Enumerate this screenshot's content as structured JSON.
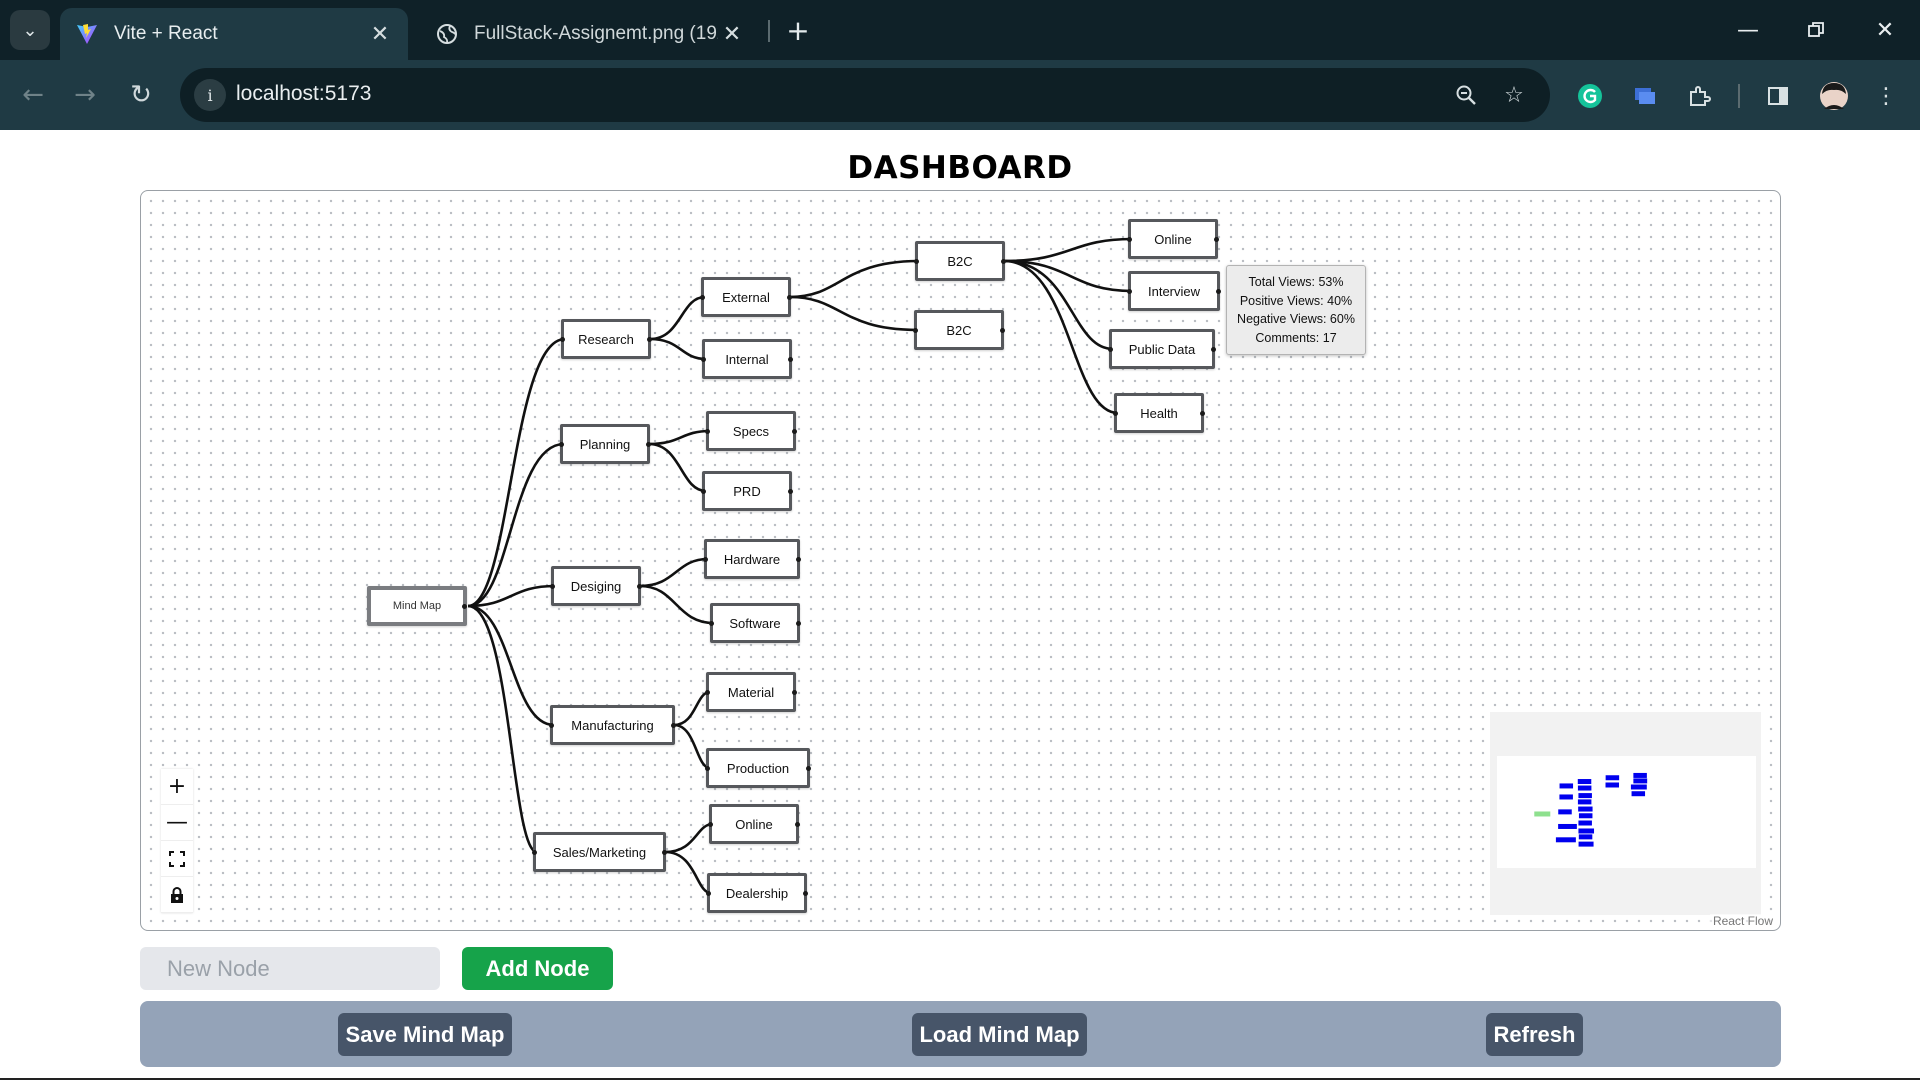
{
  "browser": {
    "tabs": [
      {
        "title": "Vite + React",
        "active": true,
        "icon": "vite-logo-icon"
      },
      {
        "title": "FullStack-Assignemt.png (1920",
        "active": false,
        "icon": "globe-icon"
      }
    ],
    "url": "localhost:5173"
  },
  "page": {
    "title": "DASHBOARD"
  },
  "mindmap": {
    "nodes": {
      "root": "Mind Map",
      "research": "Research",
      "external": "External",
      "internal": "Internal",
      "b2c_1": "B2C",
      "b2c_2": "B2C",
      "online_1": "Online",
      "interview": "Interview",
      "public_data": "Public Data",
      "health": "Health",
      "planning": "Planning",
      "specs": "Specs",
      "prd": "PRD",
      "desiging": "Desiging",
      "hardware": "Hardware",
      "software": "Software",
      "manufacturing": "Manufacturing",
      "material": "Material",
      "production": "Production",
      "sales": "Sales/Marketing",
      "online_2": "Online",
      "dealership": "Dealership"
    },
    "tooltip": {
      "total_views": "Total Views: 53%",
      "positive_views": "Positive Views: 40%",
      "negative_views": "Negative Views: 60%",
      "comments": "Comments: 17"
    },
    "attribution": "React Flow",
    "colors": {
      "minimap_node": "#0000ee",
      "minimap_root": "#8ee08e"
    }
  },
  "form": {
    "input_placeholder": "New Node",
    "input_value": "",
    "add_button": "Add Node"
  },
  "actions": {
    "save": "Save Mind Map",
    "load": "Load Mind Map",
    "refresh": "Refresh"
  }
}
